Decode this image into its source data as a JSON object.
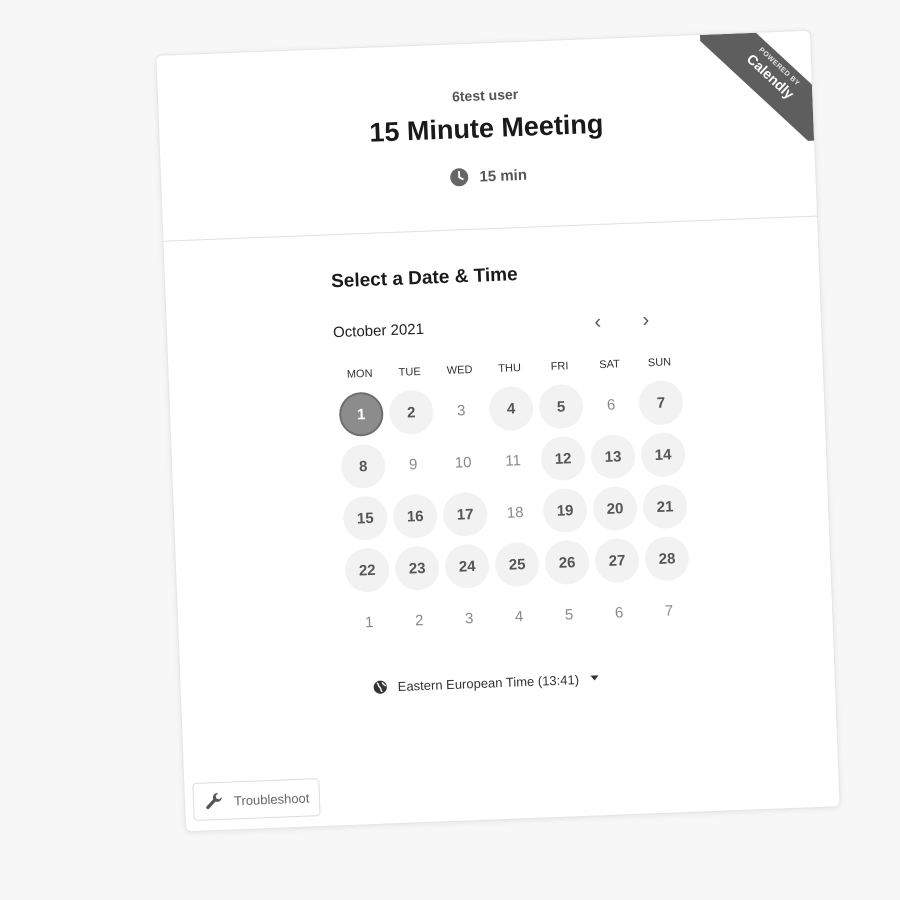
{
  "ribbon": {
    "small": "POWERED BY",
    "brand": "Calendly"
  },
  "header": {
    "owner": "6test user",
    "title": "15 Minute Meeting",
    "duration": "15 min",
    "duration_icon": "clock-icon"
  },
  "calendar": {
    "section_title": "Select a Date & Time",
    "month": "October 2021",
    "prev_icon": "chevron-left-icon",
    "next_icon": "chevron-right-icon",
    "prev_glyph": "‹",
    "next_glyph": "›",
    "weekdays": [
      "MON",
      "TUE",
      "WED",
      "THU",
      "FRI",
      "SAT",
      "SUN"
    ],
    "days": [
      {
        "label": "1",
        "state": "selected"
      },
      {
        "label": "2",
        "state": "available"
      },
      {
        "label": "3",
        "state": "unavailable"
      },
      {
        "label": "4",
        "state": "available"
      },
      {
        "label": "5",
        "state": "available"
      },
      {
        "label": "6",
        "state": "unavailable"
      },
      {
        "label": "7",
        "state": "available"
      },
      {
        "label": "8",
        "state": "available"
      },
      {
        "label": "9",
        "state": "unavailable"
      },
      {
        "label": "10",
        "state": "unavailable"
      },
      {
        "label": "11",
        "state": "unavailable"
      },
      {
        "label": "12",
        "state": "available"
      },
      {
        "label": "13",
        "state": "available"
      },
      {
        "label": "14",
        "state": "available"
      },
      {
        "label": "15",
        "state": "available"
      },
      {
        "label": "16",
        "state": "available"
      },
      {
        "label": "17",
        "state": "available"
      },
      {
        "label": "18",
        "state": "unavailable"
      },
      {
        "label": "19",
        "state": "available"
      },
      {
        "label": "20",
        "state": "available"
      },
      {
        "label": "21",
        "state": "available"
      },
      {
        "label": "22",
        "state": "available"
      },
      {
        "label": "23",
        "state": "available"
      },
      {
        "label": "24",
        "state": "available"
      },
      {
        "label": "25",
        "state": "available"
      },
      {
        "label": "26",
        "state": "available"
      },
      {
        "label": "27",
        "state": "available"
      },
      {
        "label": "28",
        "state": "available"
      },
      {
        "label": "1",
        "state": "unavailable"
      },
      {
        "label": "2",
        "state": "unavailable"
      },
      {
        "label": "3",
        "state": "unavailable"
      },
      {
        "label": "4",
        "state": "unavailable"
      },
      {
        "label": "5",
        "state": "unavailable"
      },
      {
        "label": "6",
        "state": "unavailable"
      },
      {
        "label": "7",
        "state": "unavailable"
      }
    ]
  },
  "timezone": {
    "icon": "globe-icon",
    "label": "Eastern European Time (13:41)"
  },
  "troubleshoot": {
    "icon": "wrench-icon",
    "label": "Troubleshoot"
  },
  "colors": {
    "selected_day": "#8c8c8c",
    "available_day": "#f2f2f2",
    "ribbon": "#5e5e5e"
  }
}
